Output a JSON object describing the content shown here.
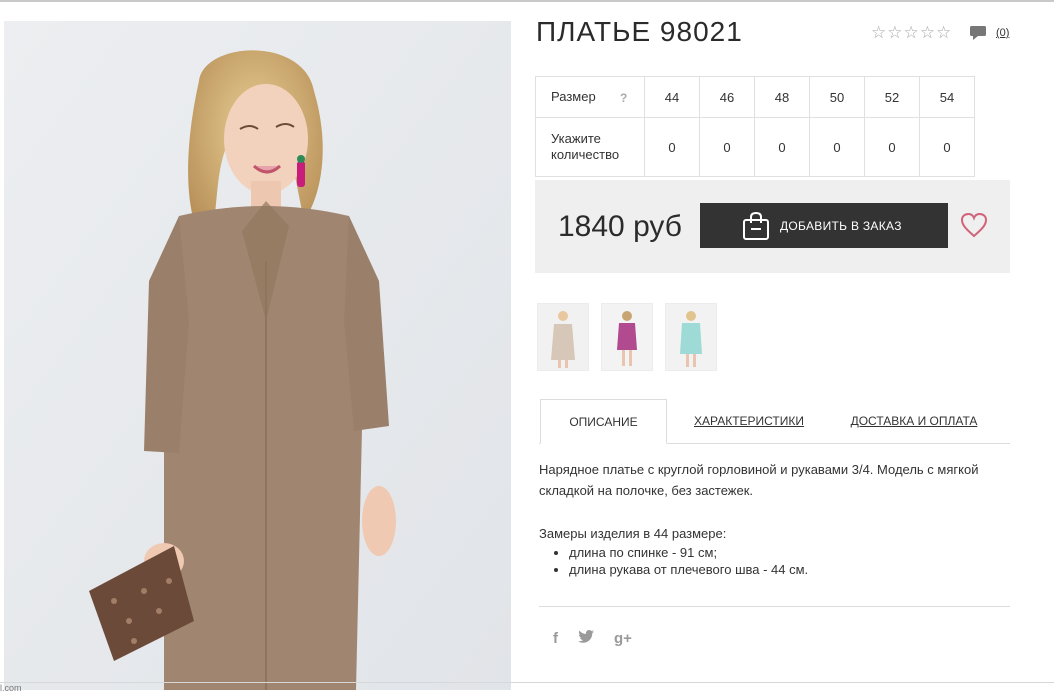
{
  "product": {
    "title": "ПЛАТЬЕ 98021",
    "comments_count": "(0)",
    "rating": 0,
    "rating_max": 5
  },
  "sizes": {
    "size_label": "Размер",
    "help_mark": "?",
    "qty_label": "Укажите количество",
    "values": [
      "44",
      "46",
      "48",
      "50",
      "52",
      "54"
    ],
    "quantities": [
      "0",
      "0",
      "0",
      "0",
      "0",
      "0"
    ]
  },
  "buy": {
    "price": "1840 руб",
    "add_label": "ДОБАВИТЬ В ЗАКАЗ"
  },
  "thumbnails": [
    {
      "color": "#d6c7b8",
      "name": "beige"
    },
    {
      "color": "#b14a8e",
      "name": "magenta"
    },
    {
      "color": "#9edbd7",
      "name": "mint"
    }
  ],
  "tabs": [
    "ОПИСАНИЕ",
    "ХАРАКТЕРИСТИКИ",
    "ДОСТАВКА И ОПЛАТА"
  ],
  "description": {
    "text": "Нарядное платье с круглой горловиной и рукавами 3/4. Модель с мягкой складкой на полочке, без застежек.",
    "measure_title": "Замеры изделия в 44 размере:",
    "measure_items": [
      "длина по спинке - 91 см;",
      "длина рукава от плечевого шва - 44 см."
    ]
  },
  "social": [
    "f",
    "t",
    "g+"
  ],
  "footer_fragment": "l.com",
  "colors": {
    "button_bg": "#333333",
    "buy_box_bg": "#efefef",
    "heart": "#d0627a",
    "dress": "#a08671"
  }
}
